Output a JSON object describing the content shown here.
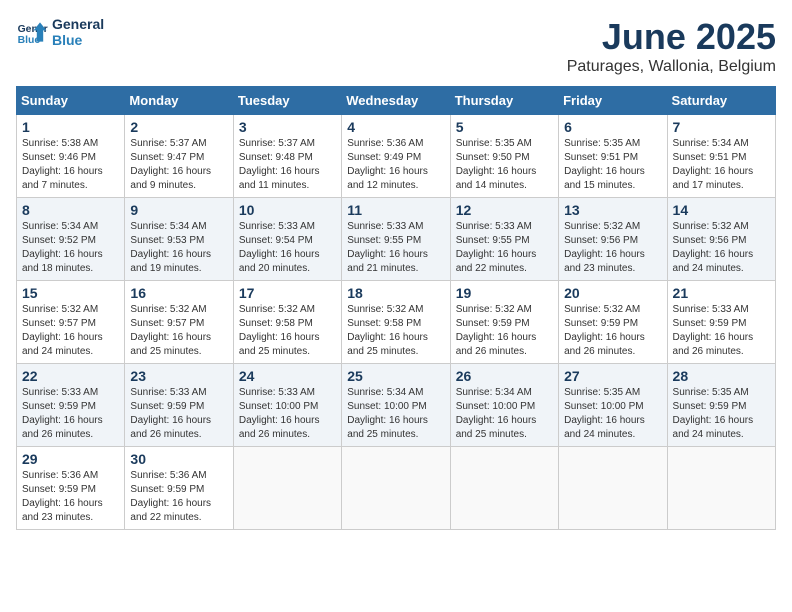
{
  "header": {
    "logo_general": "General",
    "logo_blue": "Blue",
    "month_title": "June 2025",
    "subtitle": "Paturages, Wallonia, Belgium"
  },
  "columns": [
    "Sunday",
    "Monday",
    "Tuesday",
    "Wednesday",
    "Thursday",
    "Friday",
    "Saturday"
  ],
  "weeks": [
    [
      {
        "day": "1",
        "sunrise": "Sunrise: 5:38 AM",
        "sunset": "Sunset: 9:46 PM",
        "daylight": "Daylight: 16 hours and 7 minutes."
      },
      {
        "day": "2",
        "sunrise": "Sunrise: 5:37 AM",
        "sunset": "Sunset: 9:47 PM",
        "daylight": "Daylight: 16 hours and 9 minutes."
      },
      {
        "day": "3",
        "sunrise": "Sunrise: 5:37 AM",
        "sunset": "Sunset: 9:48 PM",
        "daylight": "Daylight: 16 hours and 11 minutes."
      },
      {
        "day": "4",
        "sunrise": "Sunrise: 5:36 AM",
        "sunset": "Sunset: 9:49 PM",
        "daylight": "Daylight: 16 hours and 12 minutes."
      },
      {
        "day": "5",
        "sunrise": "Sunrise: 5:35 AM",
        "sunset": "Sunset: 9:50 PM",
        "daylight": "Daylight: 16 hours and 14 minutes."
      },
      {
        "day": "6",
        "sunrise": "Sunrise: 5:35 AM",
        "sunset": "Sunset: 9:51 PM",
        "daylight": "Daylight: 16 hours and 15 minutes."
      },
      {
        "day": "7",
        "sunrise": "Sunrise: 5:34 AM",
        "sunset": "Sunset: 9:51 PM",
        "daylight": "Daylight: 16 hours and 17 minutes."
      }
    ],
    [
      {
        "day": "8",
        "sunrise": "Sunrise: 5:34 AM",
        "sunset": "Sunset: 9:52 PM",
        "daylight": "Daylight: 16 hours and 18 minutes."
      },
      {
        "day": "9",
        "sunrise": "Sunrise: 5:34 AM",
        "sunset": "Sunset: 9:53 PM",
        "daylight": "Daylight: 16 hours and 19 minutes."
      },
      {
        "day": "10",
        "sunrise": "Sunrise: 5:33 AM",
        "sunset": "Sunset: 9:54 PM",
        "daylight": "Daylight: 16 hours and 20 minutes."
      },
      {
        "day": "11",
        "sunrise": "Sunrise: 5:33 AM",
        "sunset": "Sunset: 9:55 PM",
        "daylight": "Daylight: 16 hours and 21 minutes."
      },
      {
        "day": "12",
        "sunrise": "Sunrise: 5:33 AM",
        "sunset": "Sunset: 9:55 PM",
        "daylight": "Daylight: 16 hours and 22 minutes."
      },
      {
        "day": "13",
        "sunrise": "Sunrise: 5:32 AM",
        "sunset": "Sunset: 9:56 PM",
        "daylight": "Daylight: 16 hours and 23 minutes."
      },
      {
        "day": "14",
        "sunrise": "Sunrise: 5:32 AM",
        "sunset": "Sunset: 9:56 PM",
        "daylight": "Daylight: 16 hours and 24 minutes."
      }
    ],
    [
      {
        "day": "15",
        "sunrise": "Sunrise: 5:32 AM",
        "sunset": "Sunset: 9:57 PM",
        "daylight": "Daylight: 16 hours and 24 minutes."
      },
      {
        "day": "16",
        "sunrise": "Sunrise: 5:32 AM",
        "sunset": "Sunset: 9:57 PM",
        "daylight": "Daylight: 16 hours and 25 minutes."
      },
      {
        "day": "17",
        "sunrise": "Sunrise: 5:32 AM",
        "sunset": "Sunset: 9:58 PM",
        "daylight": "Daylight: 16 hours and 25 minutes."
      },
      {
        "day": "18",
        "sunrise": "Sunrise: 5:32 AM",
        "sunset": "Sunset: 9:58 PM",
        "daylight": "Daylight: 16 hours and 25 minutes."
      },
      {
        "day": "19",
        "sunrise": "Sunrise: 5:32 AM",
        "sunset": "Sunset: 9:59 PM",
        "daylight": "Daylight: 16 hours and 26 minutes."
      },
      {
        "day": "20",
        "sunrise": "Sunrise: 5:32 AM",
        "sunset": "Sunset: 9:59 PM",
        "daylight": "Daylight: 16 hours and 26 minutes."
      },
      {
        "day": "21",
        "sunrise": "Sunrise: 5:33 AM",
        "sunset": "Sunset: 9:59 PM",
        "daylight": "Daylight: 16 hours and 26 minutes."
      }
    ],
    [
      {
        "day": "22",
        "sunrise": "Sunrise: 5:33 AM",
        "sunset": "Sunset: 9:59 PM",
        "daylight": "Daylight: 16 hours and 26 minutes."
      },
      {
        "day": "23",
        "sunrise": "Sunrise: 5:33 AM",
        "sunset": "Sunset: 9:59 PM",
        "daylight": "Daylight: 16 hours and 26 minutes."
      },
      {
        "day": "24",
        "sunrise": "Sunrise: 5:33 AM",
        "sunset": "Sunset: 10:00 PM",
        "daylight": "Daylight: 16 hours and 26 minutes."
      },
      {
        "day": "25",
        "sunrise": "Sunrise: 5:34 AM",
        "sunset": "Sunset: 10:00 PM",
        "daylight": "Daylight: 16 hours and 25 minutes."
      },
      {
        "day": "26",
        "sunrise": "Sunrise: 5:34 AM",
        "sunset": "Sunset: 10:00 PM",
        "daylight": "Daylight: 16 hours and 25 minutes."
      },
      {
        "day": "27",
        "sunrise": "Sunrise: 5:35 AM",
        "sunset": "Sunset: 10:00 PM",
        "daylight": "Daylight: 16 hours and 24 minutes."
      },
      {
        "day": "28",
        "sunrise": "Sunrise: 5:35 AM",
        "sunset": "Sunset: 9:59 PM",
        "daylight": "Daylight: 16 hours and 24 minutes."
      }
    ],
    [
      {
        "day": "29",
        "sunrise": "Sunrise: 5:36 AM",
        "sunset": "Sunset: 9:59 PM",
        "daylight": "Daylight: 16 hours and 23 minutes."
      },
      {
        "day": "30",
        "sunrise": "Sunrise: 5:36 AM",
        "sunset": "Sunset: 9:59 PM",
        "daylight": "Daylight: 16 hours and 22 minutes."
      },
      null,
      null,
      null,
      null,
      null
    ]
  ]
}
